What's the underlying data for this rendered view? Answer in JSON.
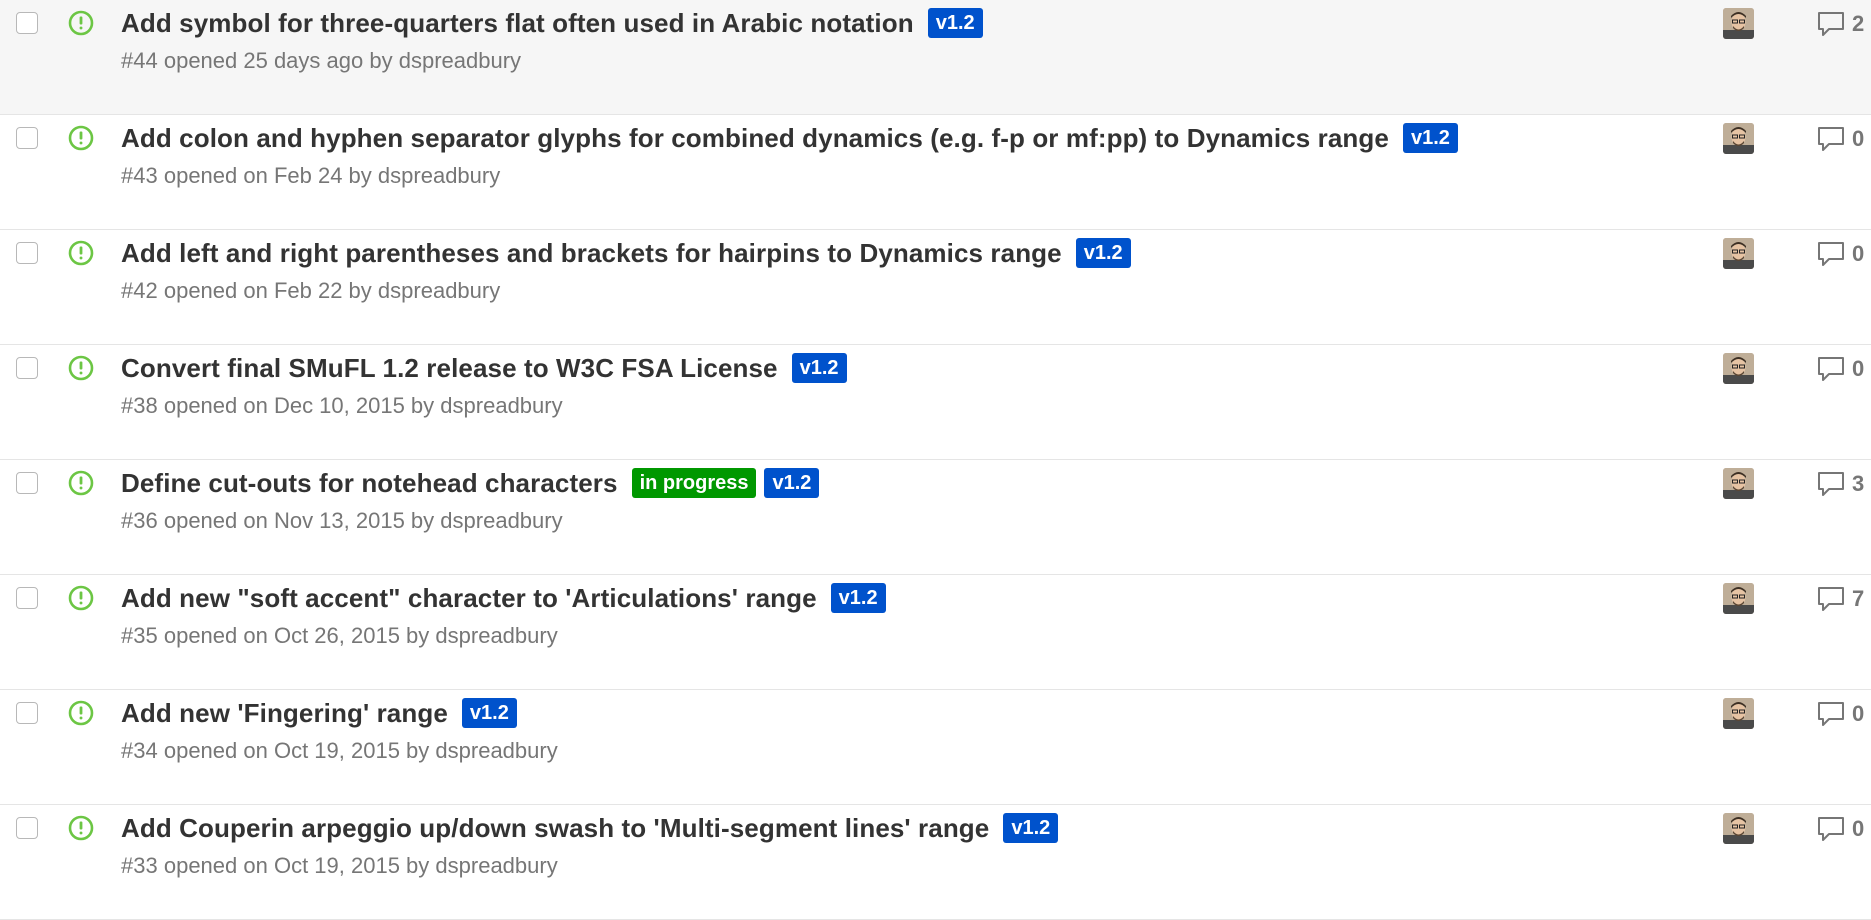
{
  "colors": {
    "open_icon": "#6cc644",
    "label_v12": "#0052cc",
    "label_in_progress": "#009800",
    "meta_text": "#767676",
    "title_text": "#333333"
  },
  "issues": [
    {
      "title": "Add symbol for three-quarters flat often used in Arabic notation",
      "labels": [
        {
          "name": "v1.2",
          "color": "#0052cc"
        }
      ],
      "number": "#44",
      "opened": "opened 25 days ago by",
      "author": "dspreadbury",
      "comments": "2",
      "hovered": true
    },
    {
      "title": "Add colon and hyphen separator glyphs for combined dynamics (e.g. f-p or mf:pp) to Dynamics range",
      "labels": [
        {
          "name": "v1.2",
          "color": "#0052cc"
        }
      ],
      "number": "#43",
      "opened": "opened on Feb 24 by",
      "author": "dspreadbury",
      "comments": "0",
      "hovered": false
    },
    {
      "title": "Add left and right parentheses and brackets for hairpins to Dynamics range",
      "labels": [
        {
          "name": "v1.2",
          "color": "#0052cc"
        }
      ],
      "number": "#42",
      "opened": "opened on Feb 22 by",
      "author": "dspreadbury",
      "comments": "0",
      "hovered": false
    },
    {
      "title": "Convert final SMuFL 1.2 release to W3C FSA License",
      "labels": [
        {
          "name": "v1.2",
          "color": "#0052cc"
        }
      ],
      "number": "#38",
      "opened": "opened on Dec 10, 2015 by",
      "author": "dspreadbury",
      "comments": "0",
      "hovered": false
    },
    {
      "title": "Define cut-outs for notehead characters",
      "labels": [
        {
          "name": "in progress",
          "color": "#009800"
        },
        {
          "name": "v1.2",
          "color": "#0052cc"
        }
      ],
      "number": "#36",
      "opened": "opened on Nov 13, 2015 by",
      "author": "dspreadbury",
      "comments": "3",
      "hovered": false
    },
    {
      "title": "Add new \"soft accent\" character to 'Articulations' range",
      "labels": [
        {
          "name": "v1.2",
          "color": "#0052cc"
        }
      ],
      "number": "#35",
      "opened": "opened on Oct 26, 2015 by",
      "author": "dspreadbury",
      "comments": "7",
      "hovered": false
    },
    {
      "title": "Add new 'Fingering' range",
      "labels": [
        {
          "name": "v1.2",
          "color": "#0052cc"
        }
      ],
      "number": "#34",
      "opened": "opened on Oct 19, 2015 by",
      "author": "dspreadbury",
      "comments": "0",
      "hovered": false
    },
    {
      "title": "Add Couperin arpeggio up/down swash to 'Multi-segment lines' range",
      "labels": [
        {
          "name": "v1.2",
          "color": "#0052cc"
        }
      ],
      "number": "#33",
      "opened": "opened on Oct 19, 2015 by",
      "author": "dspreadbury",
      "comments": "0",
      "hovered": false
    }
  ]
}
